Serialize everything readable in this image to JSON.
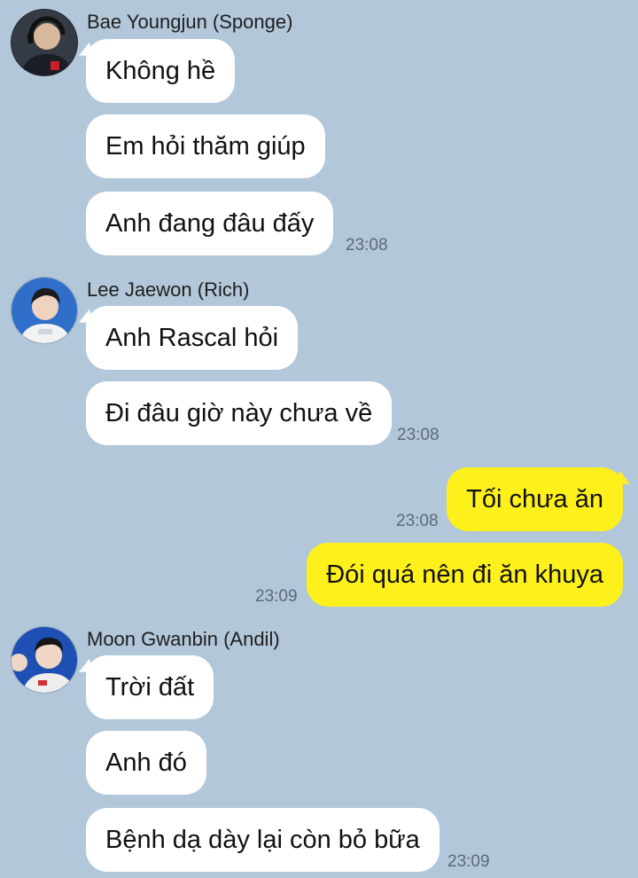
{
  "groups": [
    {
      "sender": "Bae Youngjun (Sponge)",
      "avatar_icon": "user-avatar-icon",
      "messages": [
        "Không hề",
        "Em hỏi thăm giúp",
        "Anh đang đâu đấy"
      ],
      "time": "23:08"
    },
    {
      "sender": "Lee Jaewon (Rich)",
      "avatar_icon": "user-avatar-icon",
      "messages": [
        "Anh Rascal hỏi",
        "Đi đâu giờ này chưa về"
      ],
      "time": "23:08"
    },
    {
      "sender": "Moon Gwanbin (Andil)",
      "avatar_icon": "user-avatar-icon",
      "messages": [
        "Trời đất",
        "Anh đó",
        "Bệnh dạ dày lại còn bỏ bữa"
      ],
      "time": "23:09"
    }
  ],
  "outgoing": [
    {
      "text": "Tối chưa ăn",
      "time": "23:08"
    },
    {
      "text": "Đói quá nên đi ăn khuya",
      "time": "23:09"
    }
  ],
  "colors": {
    "background": "#b2c7d9",
    "incoming_bubble": "#ffffff",
    "outgoing_bubble": "#fef01b"
  }
}
